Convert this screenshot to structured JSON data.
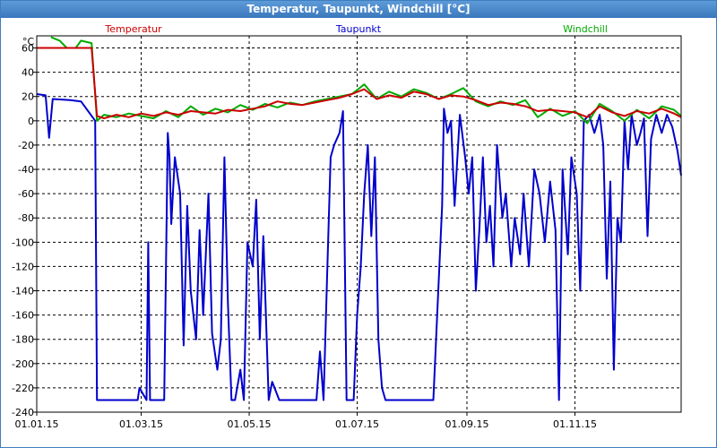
{
  "window": {
    "title": "Temperatur, Taupunkt, Windchill [°C]"
  },
  "colors": {
    "temperatur": "#cc0000",
    "taupunkt": "#0000cc",
    "windchill": "#00aa00",
    "grid": "#000000"
  },
  "chart_data": {
    "type": "line",
    "title": "Temperatur, Taupunkt, Windchill [°C]",
    "ylabel": "°C",
    "ylim": [
      -240,
      70
    ],
    "yticks": [
      60,
      40,
      20,
      0,
      -20,
      -40,
      -60,
      -80,
      -100,
      -120,
      -140,
      -160,
      -180,
      -200,
      -220,
      -240
    ],
    "xlim": [
      "2015-01-01",
      "2015-12-31"
    ],
    "xticks": [
      {
        "date": "2015-01-01",
        "label": "01.01.15"
      },
      {
        "date": "2015-03-01",
        "label": "01.03.15"
      },
      {
        "date": "2015-05-01",
        "label": "01.05.15"
      },
      {
        "date": "2015-07-01",
        "label": "01.07.15"
      },
      {
        "date": "2015-09-01",
        "label": "01.09.15"
      },
      {
        "date": "2015-11-01",
        "label": "01.11.15"
      }
    ],
    "grid": true,
    "legend_placement": "top",
    "series": [
      {
        "name": "Temperatur",
        "color": "#cc0000",
        "points": [
          [
            "2015-01-01",
            60
          ],
          [
            "2015-01-12",
            60
          ],
          [
            "2015-01-23",
            60
          ],
          [
            "2015-02-01",
            60
          ],
          [
            "2015-02-04",
            4
          ],
          [
            "2015-02-08",
            2
          ],
          [
            "2015-02-15",
            5
          ],
          [
            "2015-02-22",
            3
          ],
          [
            "2015-03-01",
            6
          ],
          [
            "2015-03-08",
            4
          ],
          [
            "2015-03-15",
            7
          ],
          [
            "2015-03-22",
            5
          ],
          [
            "2015-03-29",
            8
          ],
          [
            "2015-04-05",
            7
          ],
          [
            "2015-04-12",
            6
          ],
          [
            "2015-04-19",
            9
          ],
          [
            "2015-04-26",
            8
          ],
          [
            "2015-05-03",
            10
          ],
          [
            "2015-05-10",
            12
          ],
          [
            "2015-05-17",
            16
          ],
          [
            "2015-05-24",
            14
          ],
          [
            "2015-05-31",
            13
          ],
          [
            "2015-06-07",
            15
          ],
          [
            "2015-06-14",
            17
          ],
          [
            "2015-06-21",
            19
          ],
          [
            "2015-06-28",
            22
          ],
          [
            "2015-07-05",
            26
          ],
          [
            "2015-07-12",
            18
          ],
          [
            "2015-07-19",
            21
          ],
          [
            "2015-07-26",
            19
          ],
          [
            "2015-08-02",
            24
          ],
          [
            "2015-08-09",
            22
          ],
          [
            "2015-08-16",
            18
          ],
          [
            "2015-08-23",
            21
          ],
          [
            "2015-08-30",
            20
          ],
          [
            "2015-09-06",
            17
          ],
          [
            "2015-09-13",
            13
          ],
          [
            "2015-09-20",
            15
          ],
          [
            "2015-09-27",
            14
          ],
          [
            "2015-10-04",
            12
          ],
          [
            "2015-10-11",
            8
          ],
          [
            "2015-10-18",
            9
          ],
          [
            "2015-10-25",
            8
          ],
          [
            "2015-11-01",
            7
          ],
          [
            "2015-11-08",
            3
          ],
          [
            "2015-11-15",
            12
          ],
          [
            "2015-11-22",
            7
          ],
          [
            "2015-11-29",
            4
          ],
          [
            "2015-12-06",
            8
          ],
          [
            "2015-12-13",
            6
          ],
          [
            "2015-12-20",
            10
          ],
          [
            "2015-12-27",
            6
          ],
          [
            "2015-12-31",
            3
          ]
        ]
      },
      {
        "name": "Taupunkt",
        "color": "#0000cc",
        "points": [
          [
            "2015-01-01",
            22
          ],
          [
            "2015-01-06",
            21
          ],
          [
            "2015-01-08",
            -14
          ],
          [
            "2015-01-10",
            18
          ],
          [
            "2015-01-20",
            17
          ],
          [
            "2015-01-26",
            16
          ],
          [
            "2015-02-03",
            0
          ],
          [
            "2015-02-04",
            -230
          ],
          [
            "2015-02-22",
            -230
          ],
          [
            "2015-02-27",
            -230
          ],
          [
            "2015-02-28",
            -220
          ],
          [
            "2015-03-04",
            -230
          ],
          [
            "2015-03-05",
            -100
          ],
          [
            "2015-03-06",
            -230
          ],
          [
            "2015-03-14",
            -230
          ],
          [
            "2015-03-16",
            -10
          ],
          [
            "2015-03-17",
            -30
          ],
          [
            "2015-03-18",
            -85
          ],
          [
            "2015-03-20",
            -30
          ],
          [
            "2015-03-23",
            -60
          ],
          [
            "2015-03-25",
            -185
          ],
          [
            "2015-03-27",
            -70
          ],
          [
            "2015-03-29",
            -140
          ],
          [
            "2015-04-01",
            -180
          ],
          [
            "2015-04-03",
            -90
          ],
          [
            "2015-04-05",
            -160
          ],
          [
            "2015-04-08",
            -60
          ],
          [
            "2015-04-10",
            -175
          ],
          [
            "2015-04-13",
            -205
          ],
          [
            "2015-04-15",
            -180
          ],
          [
            "2015-04-17",
            -30
          ],
          [
            "2015-04-19",
            -150
          ],
          [
            "2015-04-21",
            -230
          ],
          [
            "2015-04-23",
            -230
          ],
          [
            "2015-04-26",
            -205
          ],
          [
            "2015-04-28",
            -230
          ],
          [
            "2015-04-30",
            -100
          ],
          [
            "2015-05-03",
            -120
          ],
          [
            "2015-05-05",
            -65
          ],
          [
            "2015-05-07",
            -180
          ],
          [
            "2015-05-09",
            -95
          ],
          [
            "2015-05-12",
            -230
          ],
          [
            "2015-05-14",
            -215
          ],
          [
            "2015-05-18",
            -230
          ],
          [
            "2015-05-25",
            -230
          ],
          [
            "2015-06-02",
            -230
          ],
          [
            "2015-06-08",
            -230
          ],
          [
            "2015-06-10",
            -190
          ],
          [
            "2015-06-12",
            -230
          ],
          [
            "2015-06-14",
            -130
          ],
          [
            "2015-06-16",
            -30
          ],
          [
            "2015-06-18",
            -20
          ],
          [
            "2015-06-21",
            -10
          ],
          [
            "2015-06-23",
            8
          ],
          [
            "2015-06-25",
            -230
          ],
          [
            "2015-06-27",
            -230
          ],
          [
            "2015-06-29",
            -230
          ],
          [
            "2015-07-01",
            -160
          ],
          [
            "2015-07-03",
            -120
          ],
          [
            "2015-07-05",
            -60
          ],
          [
            "2015-07-07",
            -20
          ],
          [
            "2015-07-09",
            -95
          ],
          [
            "2015-07-11",
            -30
          ],
          [
            "2015-07-13",
            -180
          ],
          [
            "2015-07-15",
            -220
          ],
          [
            "2015-07-17",
            -230
          ],
          [
            "2015-07-20",
            -230
          ],
          [
            "2015-07-28",
            -230
          ],
          [
            "2015-08-05",
            -230
          ],
          [
            "2015-08-13",
            -230
          ],
          [
            "2015-08-18",
            -70
          ],
          [
            "2015-08-19",
            10
          ],
          [
            "2015-08-21",
            -10
          ],
          [
            "2015-08-23",
            0
          ],
          [
            "2015-08-25",
            -70
          ],
          [
            "2015-08-28",
            5
          ],
          [
            "2015-08-31",
            -30
          ],
          [
            "2015-09-02",
            -60
          ],
          [
            "2015-09-04",
            -30
          ],
          [
            "2015-09-06",
            -140
          ],
          [
            "2015-09-08",
            -90
          ],
          [
            "2015-09-10",
            -30
          ],
          [
            "2015-09-12",
            -100
          ],
          [
            "2015-09-14",
            -70
          ],
          [
            "2015-09-16",
            -120
          ],
          [
            "2015-09-18",
            -20
          ],
          [
            "2015-09-21",
            -80
          ],
          [
            "2015-09-23",
            -60
          ],
          [
            "2015-09-26",
            -120
          ],
          [
            "2015-09-28",
            -80
          ],
          [
            "2015-10-01",
            -110
          ],
          [
            "2015-10-03",
            -60
          ],
          [
            "2015-10-06",
            -120
          ],
          [
            "2015-10-09",
            -40
          ],
          [
            "2015-10-12",
            -60
          ],
          [
            "2015-10-15",
            -100
          ],
          [
            "2015-10-18",
            -50
          ],
          [
            "2015-10-21",
            -90
          ],
          [
            "2015-10-23",
            -230
          ],
          [
            "2015-10-25",
            -40
          ],
          [
            "2015-10-28",
            -110
          ],
          [
            "2015-10-30",
            -30
          ],
          [
            "2015-11-02",
            -60
          ],
          [
            "2015-11-04",
            -140
          ],
          [
            "2015-11-06",
            0
          ],
          [
            "2015-11-09",
            5
          ],
          [
            "2015-11-12",
            -10
          ],
          [
            "2015-11-15",
            5
          ],
          [
            "2015-11-17",
            -20
          ],
          [
            "2015-11-19",
            -130
          ],
          [
            "2015-11-21",
            -50
          ],
          [
            "2015-11-23",
            -205
          ],
          [
            "2015-11-25",
            -80
          ],
          [
            "2015-11-27",
            -100
          ],
          [
            "2015-11-29",
            0
          ],
          [
            "2015-12-01",
            -40
          ],
          [
            "2015-12-03",
            5
          ],
          [
            "2015-12-06",
            -20
          ],
          [
            "2015-12-08",
            -10
          ],
          [
            "2015-12-10",
            2
          ],
          [
            "2015-12-12",
            -95
          ],
          [
            "2015-12-14",
            -15
          ],
          [
            "2015-12-17",
            5
          ],
          [
            "2015-12-20",
            -10
          ],
          [
            "2015-12-23",
            5
          ],
          [
            "2015-12-26",
            -5
          ],
          [
            "2015-12-29",
            -25
          ],
          [
            "2015-12-31",
            -45
          ]
        ]
      },
      {
        "name": "Windchill",
        "color": "#00aa00",
        "points": [
          [
            "2015-01-09",
            69
          ],
          [
            "2015-01-14",
            66
          ],
          [
            "2015-01-16",
            63
          ],
          [
            "2015-01-18",
            60
          ],
          [
            "2015-01-23",
            60
          ],
          [
            "2015-01-26",
            66
          ],
          [
            "2015-02-01",
            64
          ],
          [
            "2015-02-04",
            0
          ],
          [
            "2015-02-08",
            5
          ],
          [
            "2015-02-15",
            3
          ],
          [
            "2015-02-22",
            6
          ],
          [
            "2015-03-01",
            4
          ],
          [
            "2015-03-08",
            2
          ],
          [
            "2015-03-15",
            8
          ],
          [
            "2015-03-22",
            3
          ],
          [
            "2015-03-29",
            12
          ],
          [
            "2015-04-05",
            5
          ],
          [
            "2015-04-12",
            10
          ],
          [
            "2015-04-19",
            7
          ],
          [
            "2015-04-26",
            13
          ],
          [
            "2015-05-03",
            9
          ],
          [
            "2015-05-10",
            14
          ],
          [
            "2015-05-17",
            11
          ],
          [
            "2015-05-24",
            15
          ],
          [
            "2015-05-31",
            13
          ],
          [
            "2015-06-07",
            16
          ],
          [
            "2015-06-14",
            18
          ],
          [
            "2015-06-21",
            20
          ],
          [
            "2015-06-28",
            22
          ],
          [
            "2015-07-05",
            30
          ],
          [
            "2015-07-12",
            18
          ],
          [
            "2015-07-19",
            24
          ],
          [
            "2015-07-26",
            20
          ],
          [
            "2015-08-02",
            26
          ],
          [
            "2015-08-09",
            23
          ],
          [
            "2015-08-16",
            18
          ],
          [
            "2015-08-23",
            22
          ],
          [
            "2015-08-30",
            27
          ],
          [
            "2015-09-06",
            16
          ],
          [
            "2015-09-13",
            12
          ],
          [
            "2015-09-20",
            16
          ],
          [
            "2015-09-27",
            13
          ],
          [
            "2015-10-04",
            17
          ],
          [
            "2015-10-11",
            3
          ],
          [
            "2015-10-18",
            10
          ],
          [
            "2015-10-25",
            4
          ],
          [
            "2015-11-01",
            8
          ],
          [
            "2015-11-08",
            -2
          ],
          [
            "2015-11-15",
            14
          ],
          [
            "2015-11-22",
            8
          ],
          [
            "2015-11-29",
            0
          ],
          [
            "2015-12-06",
            9
          ],
          [
            "2015-12-13",
            2
          ],
          [
            "2015-12-20",
            12
          ],
          [
            "2015-12-27",
            9
          ],
          [
            "2015-12-31",
            4
          ]
        ]
      }
    ]
  }
}
